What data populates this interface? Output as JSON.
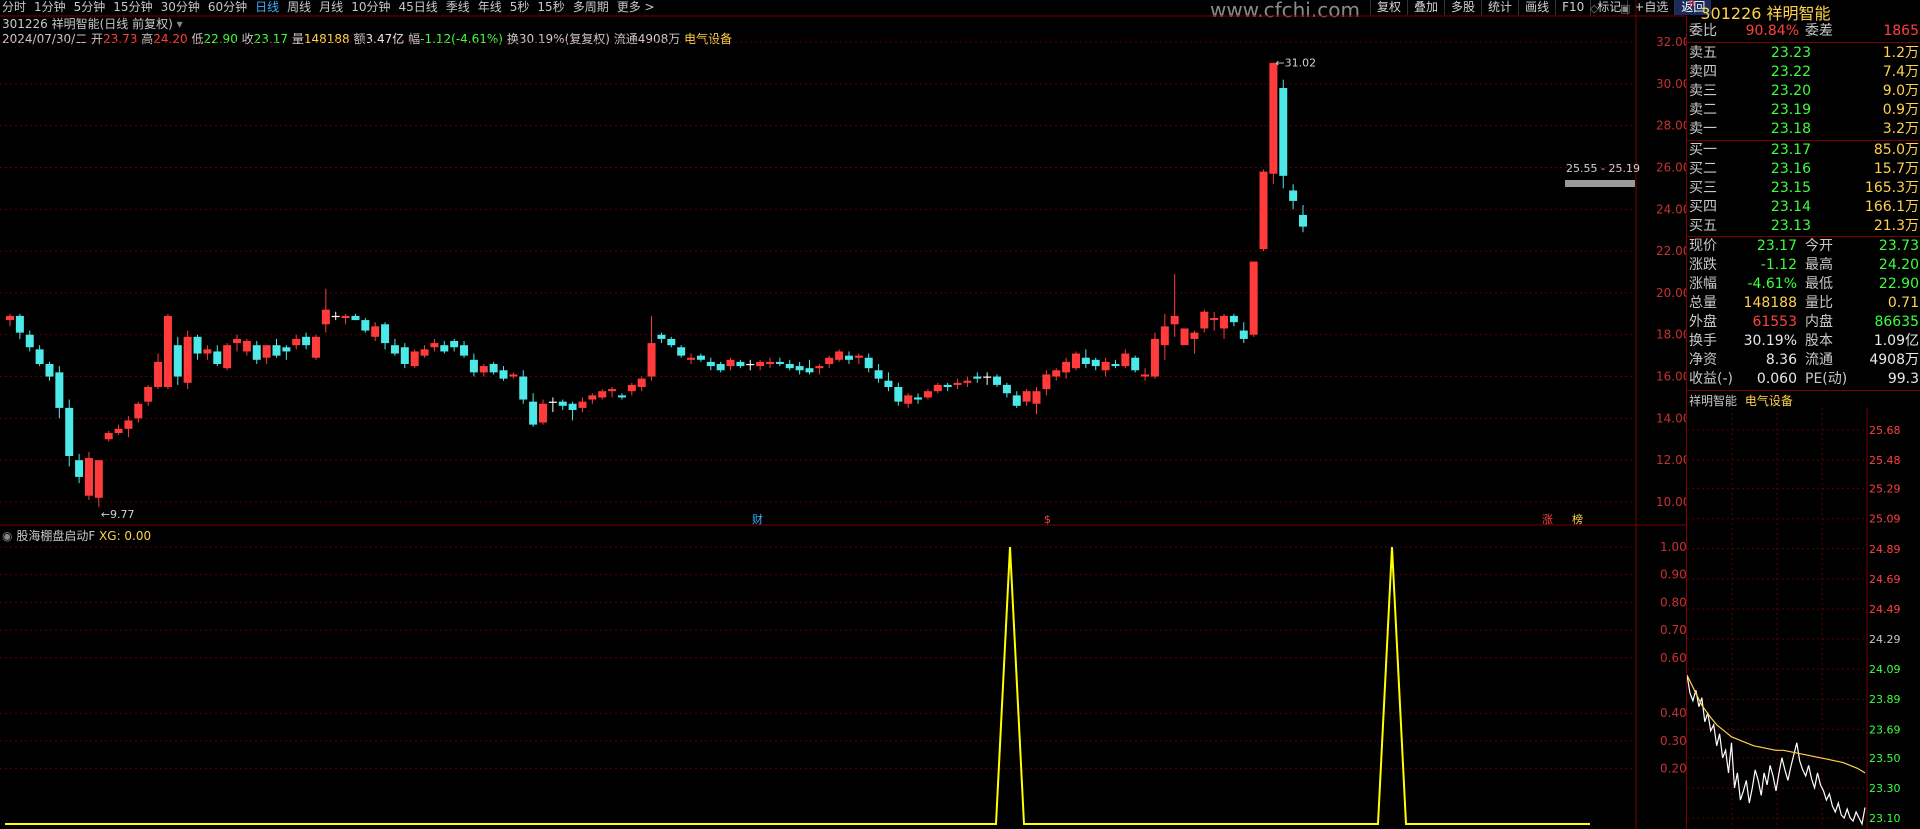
{
  "toolbar": {
    "periods": [
      "分时",
      "1分钟",
      "5分钟",
      "15分钟",
      "30分钟",
      "60分钟",
      "日线",
      "周线",
      "月线",
      "10分钟",
      "45日线",
      "季线",
      "年线",
      "5秒",
      "15秒",
      "多周期",
      "更多 >"
    ],
    "active_period": "日线",
    "right_tools": [
      "复权",
      "叠加",
      "多股",
      "统计",
      "画线",
      "F10",
      "标记",
      "+自选",
      "返回"
    ],
    "watermark": "www.cfchi.com"
  },
  "stock": {
    "title_line": "301226 祥明智能(日线 前复权)",
    "date": "2024/07/30/二",
    "open_label": "开",
    "open": "23.73",
    "high_label": "高",
    "high": "24.20",
    "low_label": "低",
    "low": "22.90",
    "close_label": "收",
    "close": "23.17",
    "vol_label": "量",
    "vol": "148188",
    "amount_label": "额",
    "amount": "3.47亿",
    "change_label": "幅",
    "change": "-1.12(-4.61%)",
    "turnover": "换30.19%(复复权)",
    "float": "流通4908万",
    "sector": "电气设备"
  },
  "kline": {
    "y_ticks": [
      "32.00",
      "30.00",
      "28.00",
      "26.00",
      "24.00",
      "22.00",
      "20.00",
      "18.00",
      "16.00",
      "14.00",
      "12.00",
      "10.00"
    ],
    "low_annotation": "9.77",
    "high_annotation": "31.02",
    "line_annotation": "25.55 - 25.19",
    "markers": [
      "财",
      "$",
      "涨",
      "榜"
    ],
    "colors": {
      "up": "#ff3b3b",
      "down": "#4de8e8",
      "neutral": "#ffffff"
    }
  },
  "indicator": {
    "name": "股海棚盘启动F",
    "xg_label": "XG: 0.00",
    "y_ticks": [
      "1.00",
      "0.90",
      "0.80",
      "0.70",
      "0.60",
      "0.40",
      "0.30",
      "0.20"
    ],
    "line_color": "#ffff00"
  },
  "quote": {
    "code_name": "301226 祥明智能",
    "weibi_label": "委比",
    "weibi": "90.84%",
    "weicha_label": "委差",
    "weicha": "1865",
    "asks": [
      {
        "label": "卖五",
        "price": "23.23",
        "vol": "1.2万"
      },
      {
        "label": "卖四",
        "price": "23.22",
        "vol": "7.4万"
      },
      {
        "label": "卖三",
        "price": "23.20",
        "vol": "9.0万"
      },
      {
        "label": "卖二",
        "price": "23.19",
        "vol": "0.9万"
      },
      {
        "label": "卖一",
        "price": "23.18",
        "vol": "3.2万"
      }
    ],
    "bids": [
      {
        "label": "买一",
        "price": "23.17",
        "vol": "85.0万"
      },
      {
        "label": "买二",
        "price": "23.16",
        "vol": "15.7万"
      },
      {
        "label": "买三",
        "price": "23.15",
        "vol": "165.3万"
      },
      {
        "label": "买四",
        "price": "23.14",
        "vol": "166.1万"
      },
      {
        "label": "买五",
        "price": "23.13",
        "vol": "21.3万"
      }
    ],
    "stats": [
      {
        "l1": "现价",
        "v1": "23.17",
        "l2": "今开",
        "v2": "23.73"
      },
      {
        "l1": "涨跌",
        "v1": "-1.12",
        "l2": "最高",
        "v2": "24.20"
      },
      {
        "l1": "涨幅",
        "v1": "-4.61%",
        "l2": "最低",
        "v2": "22.90"
      },
      {
        "l1": "总量",
        "v1": "148188",
        "l2": "量比",
        "v2": "0.71"
      },
      {
        "l1": "外盘",
        "v1": "61553",
        "l2": "内盘",
        "v2": "86635"
      },
      {
        "l1": "换手",
        "v1": "30.19%",
        "l2": "股本",
        "v2": "1.09亿"
      },
      {
        "l1": "净资",
        "v1": "8.36",
        "l2": "流通",
        "v2": "4908万"
      },
      {
        "l1": "收益(-)",
        "v1": "0.060",
        "l2": "PE(动)",
        "v2": "99.3"
      }
    ],
    "mini_name": "祥明智能",
    "mini_sector": "电气设备",
    "mini_ticks": [
      "25.68",
      "25.48",
      "25.29",
      "25.09",
      "24.89",
      "24.69",
      "24.49",
      "24.29",
      "24.09",
      "23.89",
      "23.69",
      "23.50",
      "23.30",
      "23.10"
    ]
  }
}
